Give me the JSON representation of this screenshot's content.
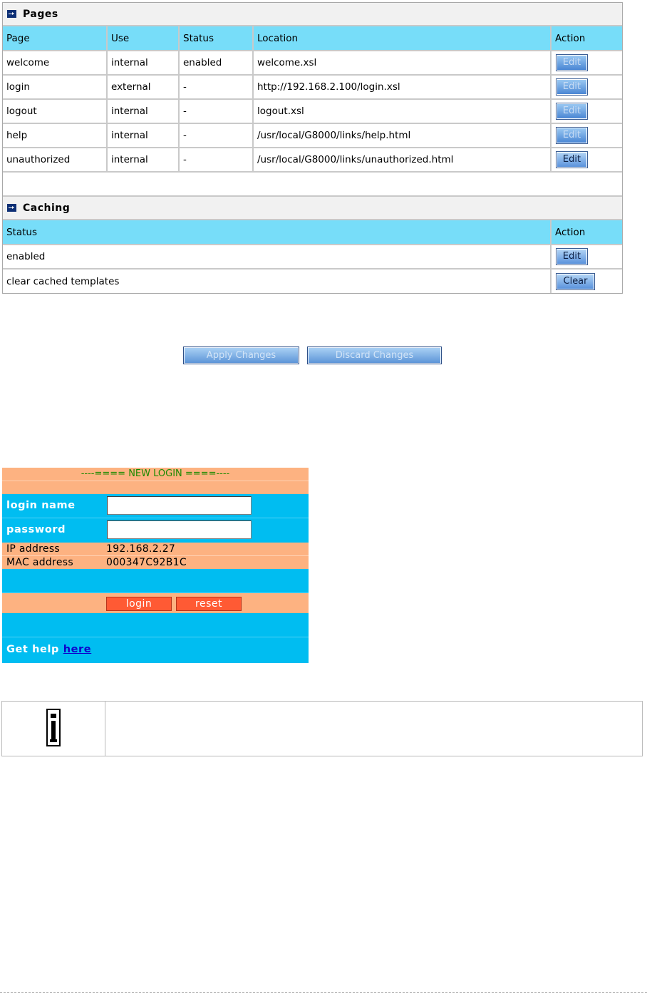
{
  "pages_section": {
    "title": "Pages",
    "headers": [
      "Page",
      "Use",
      "Status",
      "Location",
      "Action"
    ],
    "rows": [
      {
        "page": "welcome",
        "use": "internal",
        "status": "enabled",
        "location": "welcome.xsl",
        "action": "Edit"
      },
      {
        "page": "login",
        "use": "external",
        "status": "-",
        "location": "http://192.168.2.100/login.xsl",
        "action": "Edit"
      },
      {
        "page": "logout",
        "use": "internal",
        "status": "-",
        "location": "logout.xsl",
        "action": "Edit"
      },
      {
        "page": "help",
        "use": "internal",
        "status": "-",
        "location": "/usr/local/G8000/links/help.html",
        "action": "Edit"
      },
      {
        "page": "unauthorized",
        "use": "internal",
        "status": "-",
        "location": "/usr/local/G8000/links/unauthorized.html",
        "action": "Edit"
      }
    ]
  },
  "caching_section": {
    "title": "Caching",
    "headers": [
      "Status",
      "Action"
    ],
    "rows": [
      {
        "status": "enabled",
        "action": "Edit"
      },
      {
        "status": "clear cached templates",
        "action": "Clear"
      }
    ]
  },
  "form_actions": {
    "apply_label": "Apply Changes",
    "discard_label": "Discard Changes"
  },
  "login_page": {
    "banner": "----==== NEW LOGIN ====----",
    "login_name_label": "login name",
    "login_name_value": "",
    "password_label": "password",
    "password_value": "",
    "ip_label": "IP address",
    "ip_value": "192.168.2.27",
    "mac_label": "MAC address",
    "mac_value": "000347C92B1C",
    "login_button": "login",
    "reset_button": "reset",
    "help_text": "Get help",
    "help_link": "here"
  },
  "colors": {
    "header_cyan": "#77ddf9",
    "login_salmon": "#fdb281",
    "login_cyan": "#00bdf1",
    "login_button_red": "#ff5a34",
    "banner_green": "#1c8a00"
  },
  "icons": {
    "section_icon": "arrow-right-box-icon",
    "note_icon": "info-icon"
  }
}
